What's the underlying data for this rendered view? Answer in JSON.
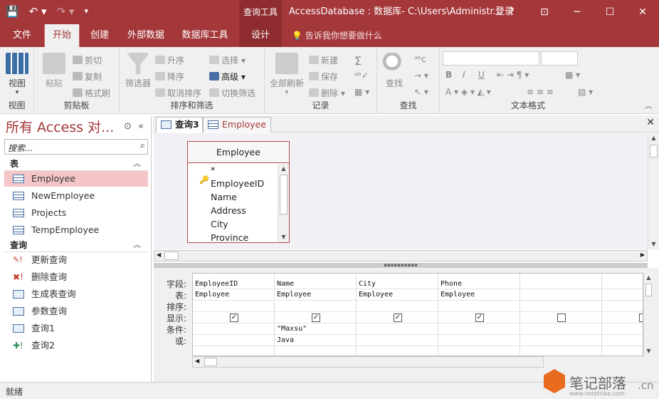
{
  "titlebar": {
    "context_tool": "查询工具",
    "title": "AccessDatabase : 数据库- C:\\Users\\Administr...",
    "login": "登录",
    "help": "?",
    "minimize": "─",
    "maximize": "☐",
    "close": "✕"
  },
  "tabs": [
    "文件",
    "开始",
    "创建",
    "外部数据",
    "数据库工具",
    "设计"
  ],
  "tell_me": "告诉我你想要做什么",
  "ribbon": {
    "view": {
      "label": "视图",
      "group": "视图"
    },
    "clipboard": {
      "paste": "粘贴",
      "cut": "剪切",
      "copy": "复制",
      "format_painter": "格式刷",
      "group": "剪贴板"
    },
    "sort_filter": {
      "filter": "筛选器",
      "asc": "升序",
      "desc": "降序",
      "remove_sort": "取消排序",
      "selection": "选择",
      "advanced": "高级",
      "toggle_filter": "切换筛选",
      "group": "排序和筛选"
    },
    "records": {
      "refresh_all": "全部刷新",
      "new": "新建",
      "save": "保存",
      "delete": "删除",
      "group": "记录"
    },
    "find": {
      "find": "查找",
      "group": "查找"
    },
    "text_format": {
      "group": "文本格式"
    }
  },
  "nav": {
    "title": "所有 Access 对...",
    "search_placeholder": "搜索...",
    "tables_header": "表",
    "tables": [
      "Employee",
      "NewEmployee",
      "Projects",
      "TempEmployee"
    ],
    "queries_header": "查询",
    "queries": [
      "更新查询",
      "删除查询",
      "生成表查询",
      "参数查询",
      "查询1",
      "查询2"
    ]
  },
  "doc_tabs": [
    "查询3",
    "Employee"
  ],
  "table_box": {
    "name": "Employee",
    "fields": [
      "*",
      "EmployeeID",
      "Name",
      "Address",
      "City",
      "Province"
    ]
  },
  "grid": {
    "row_labels": [
      "字段:",
      "表:",
      "排序:",
      "显示:",
      "条件:",
      "或:"
    ],
    "columns": [
      {
        "field": "EmployeeID",
        "table": "Employee",
        "show": true,
        "criteria": "",
        "or": ""
      },
      {
        "field": "Name",
        "table": "Employee",
        "show": true,
        "criteria": "\"Maxsu\"",
        "or": "Java"
      },
      {
        "field": "City",
        "table": "Employee",
        "show": true,
        "criteria": "",
        "or": ""
      },
      {
        "field": "Phone",
        "table": "Employee",
        "show": true,
        "criteria": "",
        "or": ""
      },
      {
        "field": "",
        "table": "",
        "show": false,
        "criteria": "",
        "or": ""
      },
      {
        "field": "",
        "table": "",
        "show": false,
        "criteria": "",
        "or": ""
      }
    ]
  },
  "status": "就绪",
  "watermark": {
    "brand": "笔记部落",
    "url": "www.notetribe.com",
    "suffix": ".cn"
  }
}
